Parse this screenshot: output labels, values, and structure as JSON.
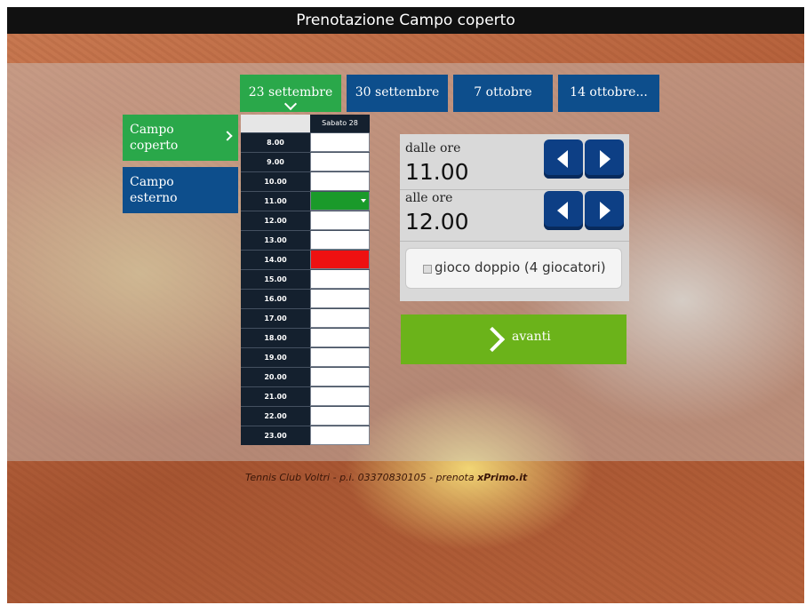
{
  "app": {
    "title": "Prenotazione Campo coperto"
  },
  "date_tabs": [
    {
      "label": "23 settembre",
      "active": true
    },
    {
      "label": "30 settembre",
      "active": false
    },
    {
      "label": "7 ottobre",
      "active": false
    },
    {
      "label": "14 ottobre...",
      "active": false
    }
  ],
  "fields": [
    {
      "label_line1": "Campo",
      "label_line2": "coperto",
      "active": true
    },
    {
      "label_line1": "Campo",
      "label_line2": "esterno",
      "active": false
    }
  ],
  "schedule": {
    "day_header": "Sabato 28",
    "rows": [
      {
        "time": "8.00",
        "status": "free"
      },
      {
        "time": "9.00",
        "status": "free"
      },
      {
        "time": "10.00",
        "status": "free"
      },
      {
        "time": "11.00",
        "status": "selected"
      },
      {
        "time": "12.00",
        "status": "free"
      },
      {
        "time": "13.00",
        "status": "free"
      },
      {
        "time": "14.00",
        "status": "busy"
      },
      {
        "time": "15.00",
        "status": "free"
      },
      {
        "time": "16.00",
        "status": "free"
      },
      {
        "time": "17.00",
        "status": "free"
      },
      {
        "time": "18.00",
        "status": "free"
      },
      {
        "time": "19.00",
        "status": "free"
      },
      {
        "time": "20.00",
        "status": "free"
      },
      {
        "time": "21.00",
        "status": "free"
      },
      {
        "time": "22.00",
        "status": "free"
      },
      {
        "time": "23.00",
        "status": "free"
      }
    ]
  },
  "time_panel": {
    "from_label": "dalle ore",
    "from_value": "11.00",
    "to_label": "alle ore",
    "to_value": "12.00",
    "doubles_label": "gioco doppio (4 giocatori)",
    "doubles_checked": false
  },
  "actions": {
    "next_label": "avanti"
  },
  "footer": {
    "text": "Tennis Club Voltri - p.i. 03370830105 - prenota ",
    "brand": "xPrimo.it"
  },
  "colors": {
    "green": "#2aa84a",
    "blue": "#0d4e8c",
    "avanti_green": "#6bb31a",
    "busy_red": "#ee1111",
    "selected_green": "#1a9a2a"
  },
  "icons": {
    "active_tab": "chevron-down-icon",
    "active_field": "chevron-right-icon",
    "decrement": "arrow-left-icon",
    "increment": "arrow-right-icon",
    "next": "chevron-right-icon"
  }
}
